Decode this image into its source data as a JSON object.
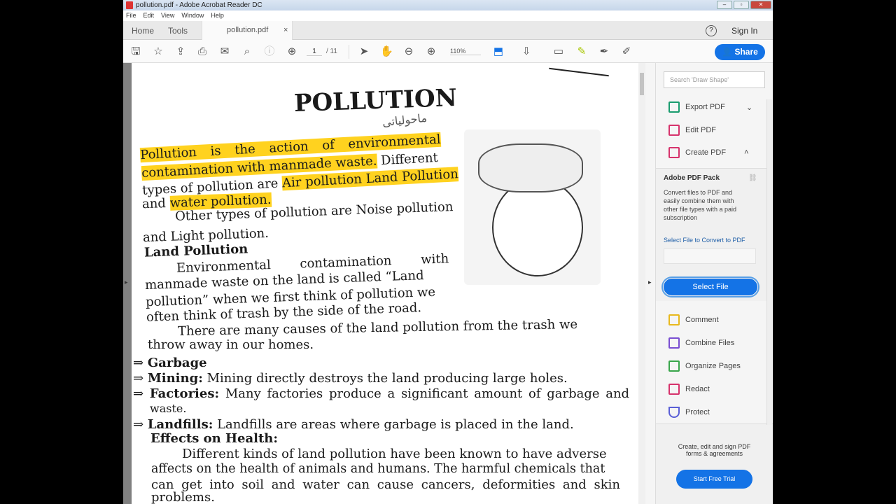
{
  "window": {
    "title": "pollution.pdf - Adobe Acrobat Reader DC"
  },
  "menu": [
    "File",
    "Edit",
    "View",
    "Window",
    "Help"
  ],
  "tabs": {
    "home": "Home",
    "tools": "Tools",
    "doc": "pollution.pdf",
    "close": "×",
    "help": "?",
    "signin": "Sign In"
  },
  "toolbar": {
    "page_current": "1",
    "page_total": "/ 11",
    "zoom": "110%",
    "share": "Share"
  },
  "document": {
    "title": "POLLUTION",
    "urdu_note": "ماحولیاتی",
    "lines": [
      "Pollution is the action of environmental",
      "contamination with manmade waste.",
      "Different",
      "types of pollution are",
      "Air pollution Land Pollution",
      "and",
      "water pollution.",
      "Other types of pollution are Noise pollution",
      "and Light pollution.",
      "Land Pollution",
      "Environmental contamination with",
      "manmade waste on the land is called “Land",
      "pollution” when we first think of pollution we",
      "often think of trash by the side of the road.",
      "There are many causes of the land pollution from the trash we",
      "throw away in our homes."
    ],
    "bullets": [
      {
        "arrow": "⇒",
        "term": "Garbage",
        "text": ""
      },
      {
        "arrow": "⇒",
        "term": "Mining:",
        "text": " Mining directly destroys the land producing large holes."
      },
      {
        "arrow": "⇒",
        "term": "Factories:",
        "text": " Many factories produce a significant amount of garbage and"
      },
      {
        "arrow": "",
        "term": "",
        "text": "waste."
      },
      {
        "arrow": "⇒",
        "term": "Landfills:",
        "text": " Landfills are areas where garbage is placed in the land."
      }
    ],
    "effects_heading": "Effects on Health:",
    "effects_lines": [
      "Different kinds of land pollution have been known to have adverse",
      "affects on the health of animals and humans. The harmful chemicals that",
      "can get into soil and water can cause cancers, deformities and skin",
      "problems."
    ]
  },
  "right_pane": {
    "search_placeholder": "Search 'Draw Shape'",
    "tools": [
      {
        "label": "Export PDF",
        "color": "#1a9c6f"
      },
      {
        "label": "Edit PDF",
        "color": "#d6336c"
      },
      {
        "label": "Create PDF",
        "color": "#d6336c"
      }
    ],
    "pack_title": "Adobe PDF Pack",
    "pack_desc": "Convert files to PDF and easily combine them with other file types with a paid subscription",
    "select_label": "Select File to Convert to PDF",
    "select_button": "Select File",
    "more_tools": [
      {
        "label": "Comment",
        "color": "#e8b91e"
      },
      {
        "label": "Combine Files",
        "color": "#7a4fd1"
      },
      {
        "label": "Organize Pages",
        "color": "#3aa64c"
      },
      {
        "label": "Redact",
        "color": "#d6336c"
      },
      {
        "label": "Protect",
        "color": "#5a5fd6"
      }
    ],
    "promo": "Create, edit and sign PDF forms & agreements",
    "trial": "Start Free Trial"
  }
}
